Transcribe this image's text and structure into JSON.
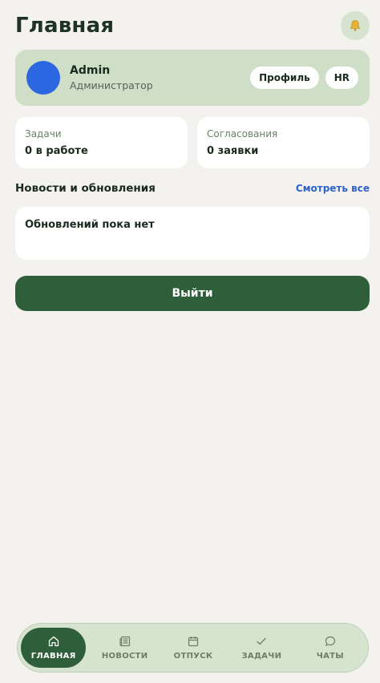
{
  "header": {
    "title": "Главная",
    "bell_icon": "bell-icon"
  },
  "profile": {
    "name": "Admin",
    "role": "Администратор",
    "avatar_color": "#2b67e0",
    "profile_button": "Профиль",
    "hr_button": "HR"
  },
  "stats": [
    {
      "label": "Задачи",
      "value": "0 в работе"
    },
    {
      "label": "Согласования",
      "value": "0 заявки"
    }
  ],
  "news": {
    "title": "Новости и обновления",
    "see_all": "Смотреть все",
    "empty_text": "Обновлений пока нет"
  },
  "logout_label": "Выйти",
  "nav": [
    {
      "label": "ГЛАВНАЯ",
      "icon": "home-icon",
      "active": true
    },
    {
      "label": "НОВОСТИ",
      "icon": "newspaper-icon",
      "active": false
    },
    {
      "label": "ОТПУСК",
      "icon": "calendar-icon",
      "active": false
    },
    {
      "label": "ЗАДАЧИ",
      "icon": "check-icon",
      "active": false
    },
    {
      "label": "ЧАТЫ",
      "icon": "chat-icon",
      "active": false
    }
  ],
  "colors": {
    "background": "#f3f2ee",
    "accent_green": "#2e5f3a",
    "profile_card": "#cfdfc7",
    "link_blue": "#2e62c8"
  }
}
